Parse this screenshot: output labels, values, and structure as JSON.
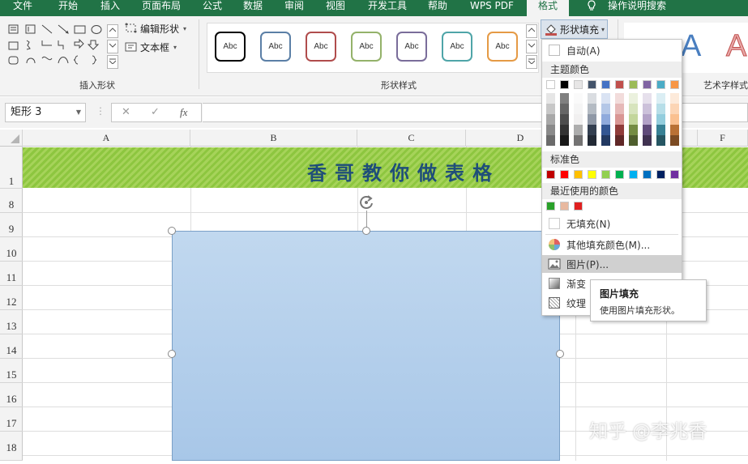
{
  "menubar": {
    "tabs": [
      "文件",
      "开始",
      "插入",
      "页面布局",
      "公式",
      "数据",
      "审阅",
      "视图",
      "开发工具",
      "帮助",
      "WPS PDF",
      "格式",
      "操作说明搜索"
    ]
  },
  "ribbon": {
    "edit_shape": "编辑形状",
    "text_box": "文本框",
    "insert_shapes_label": "插入形状",
    "shape_styles_label": "形状样式",
    "wordart_label": "艺术字样式",
    "style_sample": "Abc",
    "wordart_sample": "A",
    "style_border_colors": [
      "#000000",
      "#5b7fa6",
      "#b04c4c",
      "#94b26a",
      "#7a6d9a",
      "#4fa5a8",
      "#e59a45"
    ]
  },
  "formula": {
    "name_box": "矩形 3",
    "cancel": "✕",
    "enter": "✓",
    "fx": "fx"
  },
  "grid": {
    "columns": [
      "A",
      "B",
      "C",
      "D",
      "F"
    ],
    "rows": [
      "1",
      "8",
      "9",
      "10",
      "11",
      "12",
      "13",
      "14",
      "15",
      "16",
      "17",
      "18"
    ],
    "title": "香哥教你做表格",
    "title_color": "#1f4e79"
  },
  "fill_menu": {
    "button": "形状填充",
    "auto": "自动(A)",
    "theme_colors_head": "主题颜色",
    "standard_colors_head": "标准色",
    "recent_head": "最近使用的颜色",
    "no_fill": "无填充(N)",
    "more_colors": "其他填充颜色(M)...",
    "picture": "图片(P)...",
    "gradient": "渐变",
    "texture": "纹理",
    "theme_colors": [
      "#ffffff",
      "#000000",
      "#e7e6e6",
      "#44546a",
      "#4472c4",
      "#c0504d",
      "#9bbb59",
      "#8064a2",
      "#4bacc6",
      "#f79646"
    ],
    "standard_colors": [
      "#c00000",
      "#ff0000",
      "#ffc000",
      "#ffff00",
      "#92d050",
      "#00b050",
      "#00b0f0",
      "#0070c0",
      "#002060",
      "#7030a0"
    ],
    "recent_colors": [
      "#2aa12a",
      "#e8b9a0",
      "#e02020"
    ]
  },
  "tooltip": {
    "title": "图片填充",
    "desc": "使用图片填充形状。"
  },
  "watermark": "知乎 @李兆香"
}
